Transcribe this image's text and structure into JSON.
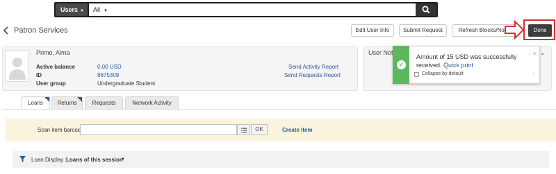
{
  "search": {
    "entity_scope": "Users",
    "field_scope": "All",
    "query": "",
    "placeholder": ""
  },
  "header": {
    "title": "Patron Services",
    "buttons": [
      "Edit User Info",
      "Submit Request",
      "Refresh Blocks/Notes"
    ],
    "done_label": "Done"
  },
  "patron": {
    "name": "Primo, Alma",
    "fields": [
      {
        "label": "Active balance",
        "value": "0.00 USD"
      },
      {
        "label": "ID",
        "value": "8675309"
      },
      {
        "label": "User group",
        "value": "Undergraduate Student"
      }
    ],
    "links": [
      "Send Activity Report",
      "Send Requests Report"
    ]
  },
  "user_notes": {
    "title": "User Notes"
  },
  "toast": {
    "message": "Amount of 15 USD was successfully received.",
    "link": "Quick print",
    "checkbox_label": "Collapse by default"
  },
  "tabs": [
    "Loans",
    "Returns",
    "Requests",
    "Network Activity"
  ],
  "scan": {
    "label": "Scan item barcode",
    "required_mark": "*",
    "value": "",
    "ok_label": "OK",
    "create_label": "Create Item"
  },
  "loan_display": {
    "label": "Loan Display :",
    "value": "Loans of this session"
  },
  "colors": {
    "accent": "#2d5a9b",
    "success": "#5cb85c",
    "highlight": "#d62f2f",
    "scan_bg": "#fbf4dc"
  },
  "icons": [
    "search-icon",
    "back-chevron-icon",
    "avatar-placeholder-icon",
    "success-check-icon",
    "close-icon",
    "list-icon",
    "filter-icon",
    "caret-down-icon"
  ]
}
